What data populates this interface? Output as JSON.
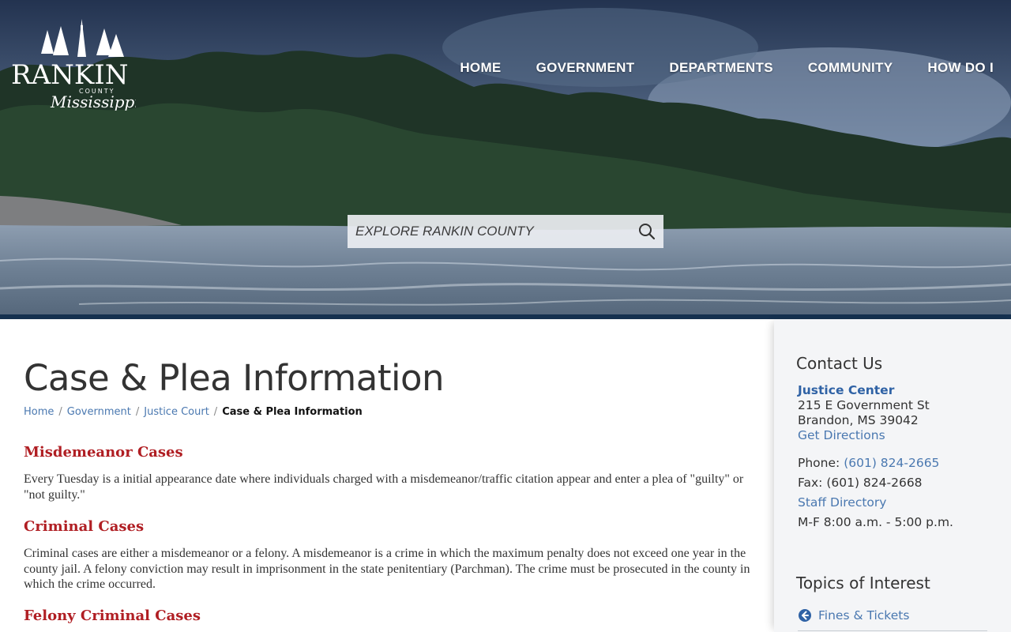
{
  "site": {
    "logo_text": "RANKIN",
    "logo_sub": "COUNTY",
    "logo_script": "Mississippi"
  },
  "nav": {
    "items": [
      "HOME",
      "GOVERNMENT",
      "DEPARTMENTS",
      "COMMUNITY",
      "HOW DO I"
    ]
  },
  "search": {
    "placeholder": "EXPLORE RANKIN COUNTY"
  },
  "page": {
    "title": "Case & Plea Information",
    "breadcrumb": [
      "Home",
      "Government",
      "Justice Court",
      "Case & Plea Information"
    ],
    "breadcrumb_sep": "/"
  },
  "sections": [
    {
      "heading": "Misdemeanor Cases",
      "body": "Every Tuesday is a initial appearance date where individuals charged with a misdemeanor/traffic citation appear and enter a plea of \"guilty\" or \"not guilty.\""
    },
    {
      "heading": "Criminal Cases",
      "body": "Criminal cases are either a misdemeanor or a felony. A misdemeanor is a crime in which the maximum penalty does not exceed one year in the county jail. A felony conviction may result in imprisonment in the state penitentiary (Parchman). The crime must be prosecuted in the county in which the crime occurred."
    },
    {
      "heading": "Felony Criminal Cases"
    }
  ],
  "sidebar": {
    "contact_heading": "Contact Us",
    "office_name": "Justice Center",
    "address_line1": "215 E Government St",
    "address_line2": "Brandon, MS 39042",
    "directions_label": "Get Directions",
    "phone_label": "Phone:",
    "phone_value": "(601) 824-2665",
    "fax_text": "Fax: (601) 824-2668",
    "staff_directory_label": "Staff Directory",
    "hours": "M-F 8:00 a.m. - 5:00 p.m.",
    "topics_heading": "Topics of Interest",
    "topics": [
      {
        "label": "Fines & Tickets",
        "icon": "arrow-circle-left-icon"
      }
    ]
  },
  "colors": {
    "accent_red": "#b01e23",
    "link_blue": "#4a78b0",
    "header_bar": "#15314f"
  }
}
